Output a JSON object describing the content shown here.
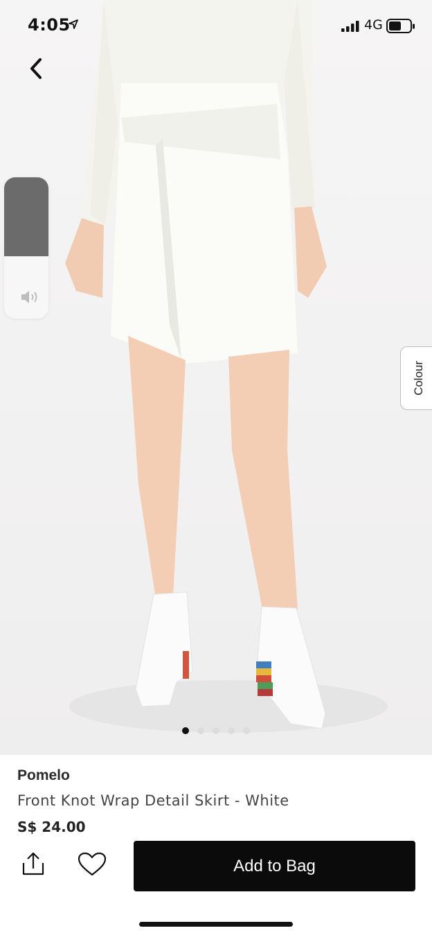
{
  "status_bar": {
    "time": "4:05",
    "network": "4G"
  },
  "product": {
    "brand": "Pomelo",
    "title": "Front Knot Wrap Detail Skirt - White",
    "price": "S$ 24.00",
    "images_count": 5,
    "active_image_index": 0
  },
  "colour_tab": {
    "label": "Colour"
  },
  "actions": {
    "add_to_bag": "Add to Bag"
  },
  "volume_hud": {
    "level": 0.56
  },
  "colors": {
    "accent": "#0b0b0b",
    "photo_bg": "#f3f2f2"
  },
  "icons": [
    "navigation-arrow-icon",
    "cellular-signal-icon",
    "battery-icon",
    "back-chevron-icon",
    "speaker-icon",
    "share-icon",
    "heart-icon"
  ]
}
